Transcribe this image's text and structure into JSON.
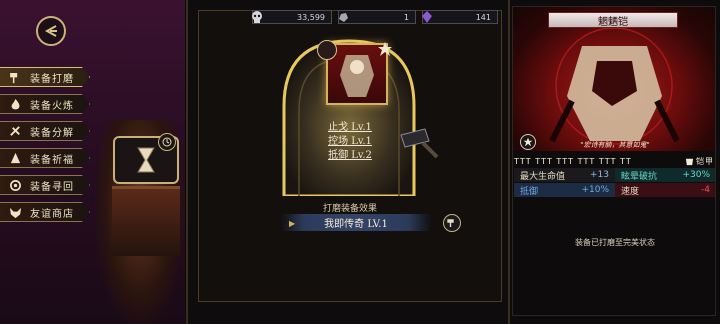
{
  "currencies": [
    {
      "icon": "skull-icon",
      "value": "33,599"
    },
    {
      "icon": "rock-icon",
      "value": "1"
    },
    {
      "icon": "purple-gem-icon",
      "value": "141"
    }
  ],
  "sidebar": {
    "items": [
      {
        "icon": "hammer-icon",
        "label": "装备打磨"
      },
      {
        "icon": "flame-icon",
        "label": "装备火炼"
      },
      {
        "icon": "disassemble-icon",
        "label": "装备分解"
      },
      {
        "icon": "pray-icon",
        "label": "装备祈福"
      },
      {
        "icon": "search-icon",
        "label": "装备寻回"
      },
      {
        "icon": "fox-icon",
        "label": "友谊商店"
      }
    ]
  },
  "center": {
    "skills": [
      "止戈 Lv.1",
      "控场 Lv.1",
      "抵御 Lv.2"
    ],
    "effect_title": "打磨装备效果",
    "effect_value": "我即传奇 LV.1"
  },
  "right": {
    "title": "魍魉铠",
    "quote": "\"宏诗有脑，其意如鬼\"",
    "rune_tag": "铠甲",
    "stats": [
      [
        {
          "name": "最大生命值",
          "value": "+13",
          "style": "dark"
        },
        {
          "name": "眩晕破抗",
          "value": "+30%",
          "style": "teal"
        }
      ],
      [
        {
          "name": "抵御",
          "value": "+10%",
          "style": "blue"
        },
        {
          "name": "速度",
          "value": "-4",
          "style": "red"
        }
      ]
    ],
    "status": "装备已打磨至完美状态"
  },
  "colors": {
    "accent": "#c9b27a",
    "brand_red": "#a81a1a",
    "sidebar_bg": "#3a1230"
  }
}
